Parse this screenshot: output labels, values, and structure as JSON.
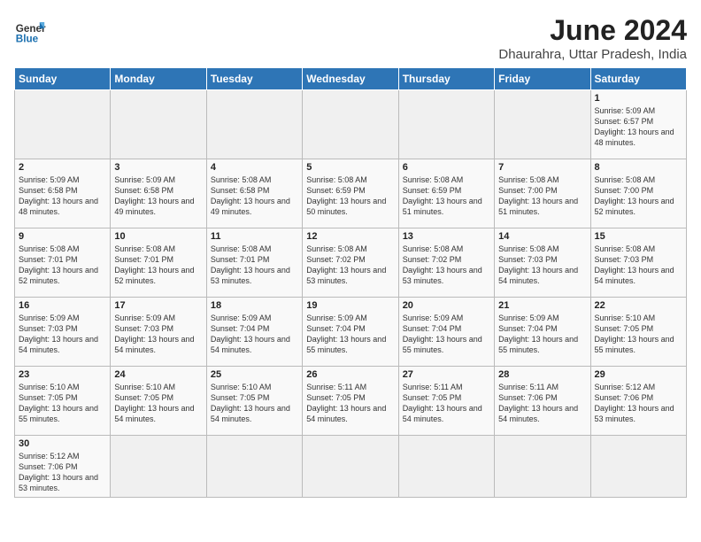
{
  "header": {
    "logo_general": "General",
    "logo_blue": "Blue",
    "title": "June 2024",
    "subtitle": "Dhaurahra, Uttar Pradesh, India"
  },
  "days_of_week": [
    "Sunday",
    "Monday",
    "Tuesday",
    "Wednesday",
    "Thursday",
    "Friday",
    "Saturday"
  ],
  "weeks": [
    [
      {
        "day": "",
        "info": ""
      },
      {
        "day": "",
        "info": ""
      },
      {
        "day": "",
        "info": ""
      },
      {
        "day": "",
        "info": ""
      },
      {
        "day": "",
        "info": ""
      },
      {
        "day": "",
        "info": ""
      },
      {
        "day": "1",
        "info": "Sunrise: 5:09 AM\nSunset: 6:57 PM\nDaylight: 13 hours and 48 minutes."
      }
    ],
    [
      {
        "day": "2",
        "info": "Sunrise: 5:09 AM\nSunset: 6:58 PM\nDaylight: 13 hours and 48 minutes."
      },
      {
        "day": "3",
        "info": "Sunrise: 5:09 AM\nSunset: 6:58 PM\nDaylight: 13 hours and 49 minutes."
      },
      {
        "day": "4",
        "info": "Sunrise: 5:08 AM\nSunset: 6:58 PM\nDaylight: 13 hours and 49 minutes."
      },
      {
        "day": "5",
        "info": "Sunrise: 5:08 AM\nSunset: 6:59 PM\nDaylight: 13 hours and 50 minutes."
      },
      {
        "day": "6",
        "info": "Sunrise: 5:08 AM\nSunset: 6:59 PM\nDaylight: 13 hours and 51 minutes."
      },
      {
        "day": "7",
        "info": "Sunrise: 5:08 AM\nSunset: 7:00 PM\nDaylight: 13 hours and 51 minutes."
      },
      {
        "day": "8",
        "info": "Sunrise: 5:08 AM\nSunset: 7:00 PM\nDaylight: 13 hours and 52 minutes."
      }
    ],
    [
      {
        "day": "9",
        "info": "Sunrise: 5:08 AM\nSunset: 7:01 PM\nDaylight: 13 hours and 52 minutes."
      },
      {
        "day": "10",
        "info": "Sunrise: 5:08 AM\nSunset: 7:01 PM\nDaylight: 13 hours and 52 minutes."
      },
      {
        "day": "11",
        "info": "Sunrise: 5:08 AM\nSunset: 7:01 PM\nDaylight: 13 hours and 53 minutes."
      },
      {
        "day": "12",
        "info": "Sunrise: 5:08 AM\nSunset: 7:02 PM\nDaylight: 13 hours and 53 minutes."
      },
      {
        "day": "13",
        "info": "Sunrise: 5:08 AM\nSunset: 7:02 PM\nDaylight: 13 hours and 53 minutes."
      },
      {
        "day": "14",
        "info": "Sunrise: 5:08 AM\nSunset: 7:03 PM\nDaylight: 13 hours and 54 minutes."
      },
      {
        "day": "15",
        "info": "Sunrise: 5:08 AM\nSunset: 7:03 PM\nDaylight: 13 hours and 54 minutes."
      }
    ],
    [
      {
        "day": "16",
        "info": "Sunrise: 5:09 AM\nSunset: 7:03 PM\nDaylight: 13 hours and 54 minutes."
      },
      {
        "day": "17",
        "info": "Sunrise: 5:09 AM\nSunset: 7:03 PM\nDaylight: 13 hours and 54 minutes."
      },
      {
        "day": "18",
        "info": "Sunrise: 5:09 AM\nSunset: 7:04 PM\nDaylight: 13 hours and 54 minutes."
      },
      {
        "day": "19",
        "info": "Sunrise: 5:09 AM\nSunset: 7:04 PM\nDaylight: 13 hours and 55 minutes."
      },
      {
        "day": "20",
        "info": "Sunrise: 5:09 AM\nSunset: 7:04 PM\nDaylight: 13 hours and 55 minutes."
      },
      {
        "day": "21",
        "info": "Sunrise: 5:09 AM\nSunset: 7:04 PM\nDaylight: 13 hours and 55 minutes."
      },
      {
        "day": "22",
        "info": "Sunrise: 5:10 AM\nSunset: 7:05 PM\nDaylight: 13 hours and 55 minutes."
      }
    ],
    [
      {
        "day": "23",
        "info": "Sunrise: 5:10 AM\nSunset: 7:05 PM\nDaylight: 13 hours and 55 minutes."
      },
      {
        "day": "24",
        "info": "Sunrise: 5:10 AM\nSunset: 7:05 PM\nDaylight: 13 hours and 54 minutes."
      },
      {
        "day": "25",
        "info": "Sunrise: 5:10 AM\nSunset: 7:05 PM\nDaylight: 13 hours and 54 minutes."
      },
      {
        "day": "26",
        "info": "Sunrise: 5:11 AM\nSunset: 7:05 PM\nDaylight: 13 hours and 54 minutes."
      },
      {
        "day": "27",
        "info": "Sunrise: 5:11 AM\nSunset: 7:05 PM\nDaylight: 13 hours and 54 minutes."
      },
      {
        "day": "28",
        "info": "Sunrise: 5:11 AM\nSunset: 7:06 PM\nDaylight: 13 hours and 54 minutes."
      },
      {
        "day": "29",
        "info": "Sunrise: 5:12 AM\nSunset: 7:06 PM\nDaylight: 13 hours and 53 minutes."
      }
    ],
    [
      {
        "day": "30",
        "info": "Sunrise: 5:12 AM\nSunset: 7:06 PM\nDaylight: 13 hours and 53 minutes."
      },
      {
        "day": "",
        "info": ""
      },
      {
        "day": "",
        "info": ""
      },
      {
        "day": "",
        "info": ""
      },
      {
        "day": "",
        "info": ""
      },
      {
        "day": "",
        "info": ""
      },
      {
        "day": "",
        "info": ""
      }
    ]
  ]
}
